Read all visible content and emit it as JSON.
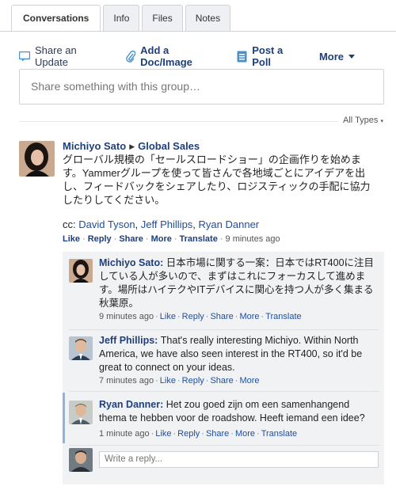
{
  "tabs": [
    {
      "label": "Conversations",
      "active": true
    },
    {
      "label": "Info"
    },
    {
      "label": "Files"
    },
    {
      "label": "Notes"
    }
  ],
  "publisher": {
    "share_update": "Share an Update",
    "add_doc": "Add a Doc/Image",
    "post_poll": "Post a Poll",
    "more": "More"
  },
  "share_placeholder": "Share something with this group…",
  "filter": "All Types",
  "post": {
    "author": "Michiyo Sato",
    "group": "Global Sales",
    "body": "グローバル規模の「セールスロードショー」の企画作りを始めます。Yammerグループを使って皆さんで各地域ごとにアイデアを出し、フィードバックをシェアしたり、ロジスティックの手配に協力したりしてください。",
    "cc_label": "cc:",
    "cc": [
      "David Tyson",
      "Jeff Phillips",
      "Ryan Danner"
    ],
    "actions": {
      "like": "Like",
      "reply": "Reply",
      "share": "Share",
      "more": "More",
      "translate": "Translate",
      "time": "9 minutes ago"
    }
  },
  "replies": [
    {
      "author": "Michiyo Sato",
      "text": "日本市場に関する一案：日本ではRT400に注目している人が多いので、まずはこれにフォーカスして進めます。場所はハイテクやITデバイスに関心を持つ人が多く集まる秋葉原。",
      "time": "9 minutes ago",
      "like": "Like",
      "reply": "Reply",
      "share": "Share",
      "more": "More",
      "translate": "Translate"
    },
    {
      "author": "Jeff Phillips",
      "text": "That's really interesting Michiyo. Within North America, we have also seen interest in the RT400, so it'd be great to connect on your ideas.",
      "time": "7 minutes ago",
      "like": "Like",
      "reply": "Reply",
      "share": "Share",
      "more": "More"
    },
    {
      "author": "Ryan Danner",
      "text": "Het zou goed zijn om een samenhangend thema te hebben voor de roadshow. Heeft iemand een idee?",
      "time": "1 minute ago",
      "like": "Like",
      "reply": "Reply",
      "share": "Share",
      "more": "More",
      "translate": "Translate"
    }
  ],
  "reply_placeholder": "Write a reply..."
}
